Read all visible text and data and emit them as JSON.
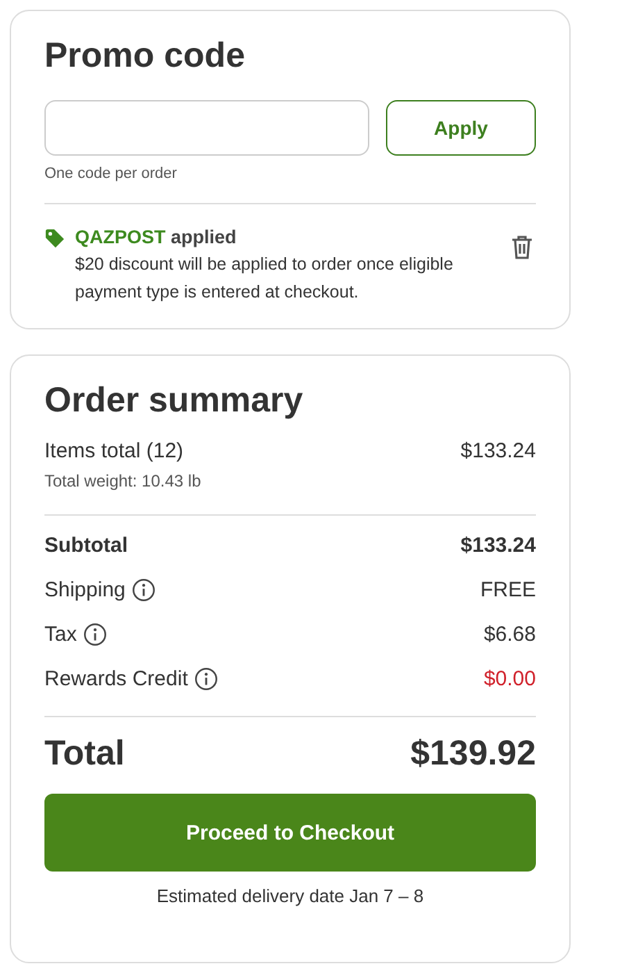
{
  "promo": {
    "title": "Promo code",
    "apply_button": "Apply",
    "hint": "One code per order",
    "applied": {
      "code": "QAZPOST",
      "status": "applied",
      "message": "$20 discount will be applied to order once eligible payment type is entered at checkout."
    }
  },
  "summary": {
    "title": "Order summary",
    "items_row": {
      "label": "Items total (12)",
      "value": "$133.24",
      "note": "Total weight: 10.43 lb"
    },
    "rows": [
      {
        "label": "Subtotal",
        "value": "$133.24",
        "kind": "bold",
        "info": false
      },
      {
        "label": "Shipping",
        "value": "FREE",
        "kind": "plain",
        "info": true
      },
      {
        "label": "Tax",
        "value": "$6.68",
        "kind": "plain",
        "info": true
      },
      {
        "label": "Rewards Credit",
        "value": "$0.00",
        "kind": "credit",
        "info": true
      }
    ],
    "total": {
      "label": "Total",
      "value": "$139.92"
    },
    "checkout_button": "Proceed to Checkout",
    "delivery": "Estimated delivery date Jan 7 – 8"
  }
}
